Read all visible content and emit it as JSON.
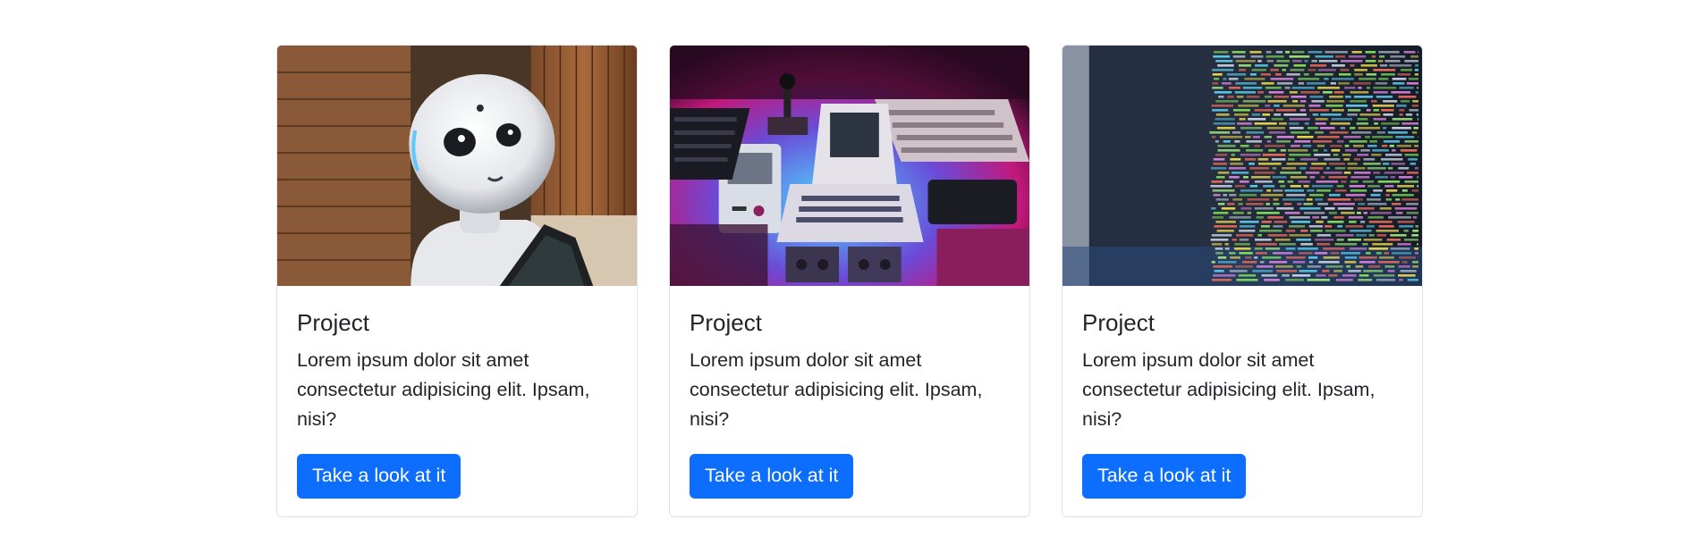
{
  "cards": [
    {
      "image_subject": "robot-photo",
      "title": "Project",
      "text": "Lorem ipsum dolor sit amet consectetur adipisicing elit. Ipsam, nisi?",
      "button_label": "Take a look at it"
    },
    {
      "image_subject": "retro-computers-photo",
      "title": "Project",
      "text": "Lorem ipsum dolor sit amet consectetur adipisicing elit. Ipsam, nisi?",
      "button_label": "Take a look at it"
    },
    {
      "image_subject": "code-screen-photo",
      "title": "Project",
      "text": "Lorem ipsum dolor sit amet consectetur adipisicing elit. Ipsam, nisi?",
      "button_label": "Take a look at it"
    }
  ],
  "colors": {
    "button_bg": "#0d6efd",
    "button_text": "#ffffff",
    "card_border": "#dfe2e6",
    "text": "#212529"
  }
}
